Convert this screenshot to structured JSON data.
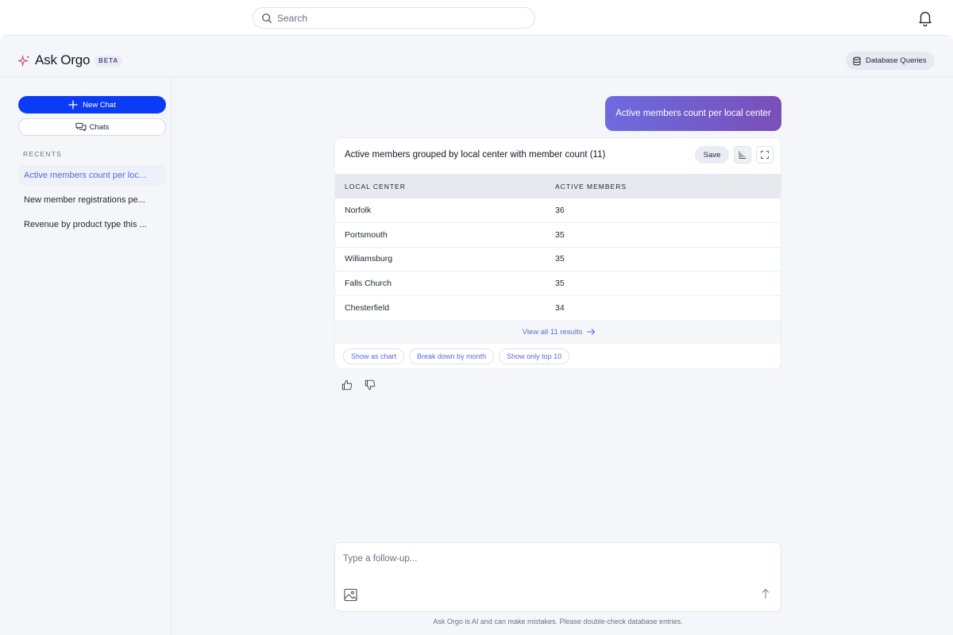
{
  "topbar": {
    "search_placeholder": "Search"
  },
  "header": {
    "title": "Ask Orgo",
    "badge": "BETA",
    "database_button": "Database Queries"
  },
  "sidebar": {
    "new_chat": "New Chat",
    "chats": "Chats",
    "recents_label": "RECENTS",
    "items": [
      {
        "label": "Active members count per loc...",
        "active": true
      },
      {
        "label": "New member registrations pe...",
        "active": false
      },
      {
        "label": "Revenue by product type this ...",
        "active": false
      }
    ]
  },
  "chat": {
    "user_message": "Active members count per local center",
    "result": {
      "title": "Active members grouped by local center with member count (11)",
      "save_label": "Save",
      "columns": [
        "LOCAL CENTER",
        "ACTIVE MEMBERS"
      ],
      "rows": [
        [
          "Norfolk",
          "36"
        ],
        [
          "Portsmouth",
          "35"
        ],
        [
          "Williamsburg",
          "35"
        ],
        [
          "Falls Church",
          "35"
        ],
        [
          "Chesterfield",
          "34"
        ]
      ],
      "view_all": "View all 11 results",
      "suggestions": [
        "Show as chart",
        "Break down by month",
        "Show only top 10"
      ]
    }
  },
  "composer": {
    "placeholder": "Type a follow-up...",
    "disclaimer": "Ask Orgo is AI and can make mistakes. Please double-check database entries."
  },
  "colors": {
    "accent": "#0a3cf5",
    "link": "#5b6ad6",
    "bubble_start": "#6d6be0",
    "bubble_end": "#7a4fb8"
  }
}
